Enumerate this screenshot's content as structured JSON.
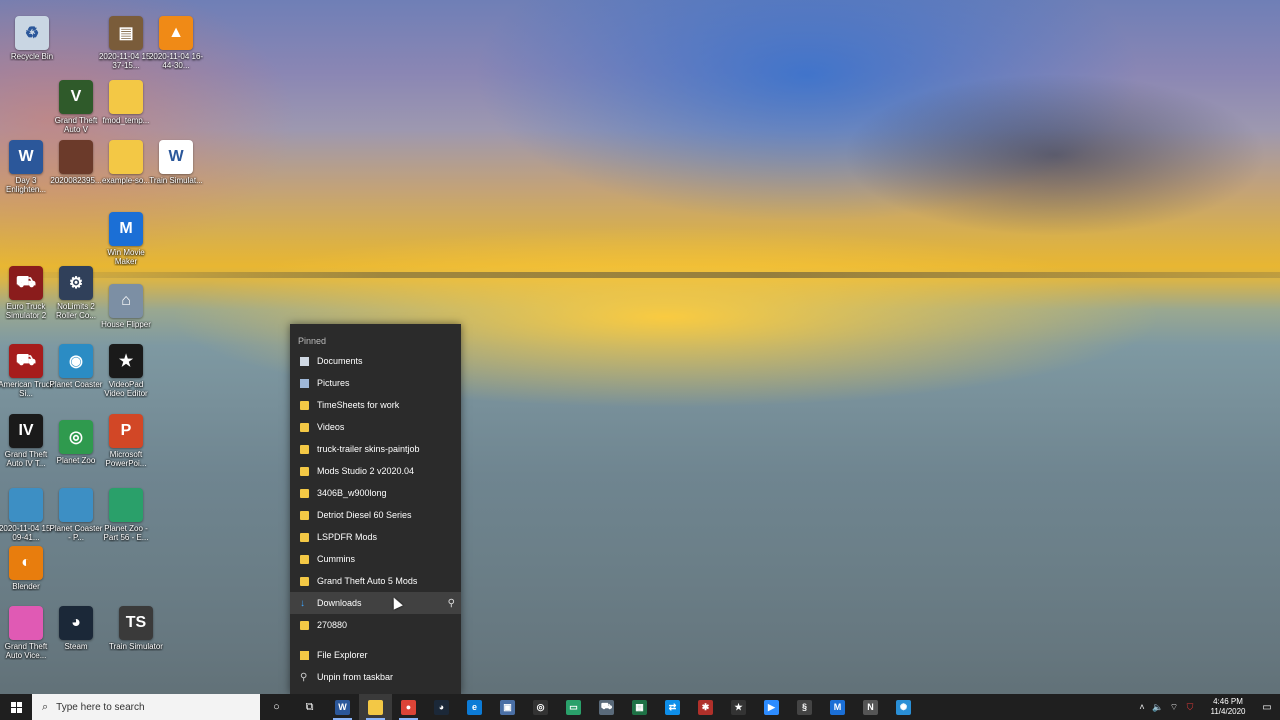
{
  "desktop_icons": [
    {
      "label": "Recycle Bin",
      "icon": "recycle-bin-icon",
      "color": "#c9d6e3",
      "glyph": "♻"
    },
    {
      "label": "2020-11-04 15-37-15...",
      "icon": "video-file-icon",
      "color": "#7a5c3a",
      "glyph": "▤"
    },
    {
      "label": "2020-11-04 16-44-30...",
      "icon": "vlc-icon",
      "color": "#f08a16",
      "glyph": "▲"
    },
    {
      "label": "Grand Theft Auto V",
      "icon": "gta-v-icon",
      "color": "#2f5a2a",
      "glyph": "V"
    },
    {
      "label": "fmod_temp...",
      "icon": "folder-icon",
      "color": "#f3c845",
      "glyph": ""
    },
    {
      "label": "Day 3 Enlighten...",
      "icon": "word-doc-icon",
      "color": "#2b579a",
      "glyph": "W"
    },
    {
      "label": "2020082395...",
      "icon": "photo-icon",
      "color": "#6b3a2a",
      "glyph": ""
    },
    {
      "label": "example-so...",
      "icon": "folder-icon",
      "color": "#f3c845",
      "glyph": ""
    },
    {
      "label": "Train Simulat...",
      "icon": "word-doc-icon",
      "color": "#ffffff",
      "glyph": "W"
    },
    {
      "label": "Win Movie Maker",
      "icon": "movie-maker-icon",
      "color": "#1b6fd6",
      "glyph": "M"
    },
    {
      "label": "Euro Truck Simulator 2",
      "icon": "ets2-icon",
      "color": "#8a1c1c",
      "glyph": "⛟"
    },
    {
      "label": "NoLimits 2 Roller Co...",
      "icon": "nolimits-icon",
      "color": "#30405a",
      "glyph": "⚙"
    },
    {
      "label": "House Flipper",
      "icon": "house-flipper-icon",
      "color": "#7c8fa4",
      "glyph": "⌂"
    },
    {
      "label": "American Truck Si...",
      "icon": "ats-icon",
      "color": "#a61c1c",
      "glyph": "⛟"
    },
    {
      "label": "Planet Coaster",
      "icon": "planet-coaster-icon",
      "color": "#2b8cc4",
      "glyph": "◉"
    },
    {
      "label": "VideoPad Video Editor",
      "icon": "videopad-icon",
      "color": "#1a1a1a",
      "glyph": "★"
    },
    {
      "label": "Grand Theft Auto IV T...",
      "icon": "gta-iv-icon",
      "color": "#1a1a1a",
      "glyph": "IV"
    },
    {
      "label": "Planet Zoo",
      "icon": "planet-zoo-icon",
      "color": "#2f9a4e",
      "glyph": "◎"
    },
    {
      "label": "Microsoft PowerPoi...",
      "icon": "powerpoint-icon",
      "color": "#d24726",
      "glyph": "P"
    },
    {
      "label": "2020-11-04 15-09-41...",
      "icon": "image-file-icon",
      "color": "#3d8fc4",
      "glyph": ""
    },
    {
      "label": "Planet Coaster - P...",
      "icon": "image-file-icon",
      "color": "#3d8fc4",
      "glyph": ""
    },
    {
      "label": "Planet Zoo - Part 56 - E...",
      "icon": "image-file-icon",
      "color": "#2aa06a",
      "glyph": ""
    },
    {
      "label": "Blender",
      "icon": "blender-icon",
      "color": "#e87d0d",
      "glyph": "◐"
    },
    {
      "label": "Grand Theft Auto Vice...",
      "icon": "gta-vc-icon",
      "color": "#e05ab4",
      "glyph": ""
    },
    {
      "label": "Steam",
      "icon": "steam-icon",
      "color": "#1b2838",
      "glyph": "◕"
    },
    {
      "label": "Train Simulator",
      "icon": "train-sim-icon",
      "color": "#3a3a3a",
      "glyph": "TS"
    }
  ],
  "jumplist": {
    "header": "Pinned",
    "items": [
      {
        "label": "Documents",
        "icon": "documents-icon"
      },
      {
        "label": "Pictures",
        "icon": "pictures-icon"
      },
      {
        "label": "TimeSheets for work",
        "icon": "folder-icon"
      },
      {
        "label": "Videos",
        "icon": "folder-icon"
      },
      {
        "label": "truck-trailer skins-paintjob",
        "icon": "folder-icon"
      },
      {
        "label": "Mods Studio 2 v2020.04",
        "icon": "folder-icon"
      },
      {
        "label": "3406B_w900long",
        "icon": "folder-icon"
      },
      {
        "label": "Detriot Diesel 60 Series",
        "icon": "folder-icon"
      },
      {
        "label": "LSPDFR Mods",
        "icon": "folder-icon"
      },
      {
        "label": "Cummins",
        "icon": "folder-icon"
      },
      {
        "label": "Grand Theft Auto 5 Mods",
        "icon": "folder-icon"
      },
      {
        "label": "Downloads",
        "icon": "downloads-icon"
      },
      {
        "label": "270880",
        "icon": "folder-icon"
      }
    ],
    "actions": [
      {
        "label": "File Explorer",
        "icon": "file-explorer-icon"
      },
      {
        "label": "Unpin from taskbar",
        "icon": "unpin-icon"
      }
    ],
    "hovered_item": "Downloads"
  },
  "taskbar": {
    "search_placeholder": "Type here to search",
    "apps": [
      {
        "name": "word",
        "icon": "word-icon",
        "color": "#2b579a",
        "glyph": "W"
      },
      {
        "name": "file-explorer",
        "icon": "file-explorer-icon",
        "color": "#f3c845",
        "glyph": ""
      },
      {
        "name": "chrome",
        "icon": "chrome-icon",
        "color": "#db4437",
        "glyph": "●"
      },
      {
        "name": "steam",
        "icon": "steam-icon",
        "color": "#1b2838",
        "glyph": "◕"
      },
      {
        "name": "edge",
        "icon": "edge-icon",
        "color": "#0c7bd6",
        "glyph": "e"
      },
      {
        "name": "app-window",
        "icon": "app-window-icon",
        "color": "#4a6fa5",
        "glyph": "▣"
      },
      {
        "name": "obs",
        "icon": "obs-icon",
        "color": "#333333",
        "glyph": "◎"
      },
      {
        "name": "camtasia",
        "icon": "recorder-icon",
        "color": "#2aa06a",
        "glyph": "▭"
      },
      {
        "name": "truck-sim",
        "icon": "truck-icon",
        "color": "#5a6a7a",
        "glyph": "⛟"
      },
      {
        "name": "spreadsheet",
        "icon": "spreadsheet-icon",
        "color": "#1e7145",
        "glyph": "▦"
      },
      {
        "name": "teamviewer",
        "icon": "teamviewer-icon",
        "color": "#0e8ee9",
        "glyph": "⇄"
      },
      {
        "name": "bug-app",
        "icon": "spider-icon",
        "color": "#b0302a",
        "glyph": "✱"
      },
      {
        "name": "videopad",
        "icon": "videopad-icon",
        "color": "#333333",
        "glyph": "★"
      },
      {
        "name": "zoom",
        "icon": "zoom-icon",
        "color": "#2d8cff",
        "glyph": "▶"
      },
      {
        "name": "blender-like",
        "icon": "swirl-icon",
        "color": "#444444",
        "glyph": "§"
      },
      {
        "name": "movie-maker",
        "icon": "movie-maker-icon",
        "color": "#1b6fd6",
        "glyph": "M"
      },
      {
        "name": "notepad",
        "icon": "notepad-icon",
        "color": "#555555",
        "glyph": "N"
      },
      {
        "name": "network-app",
        "icon": "network-icon",
        "color": "#2a8fd6",
        "glyph": "✺"
      }
    ],
    "time": "4:46 PM",
    "date": "11/4/2020"
  }
}
